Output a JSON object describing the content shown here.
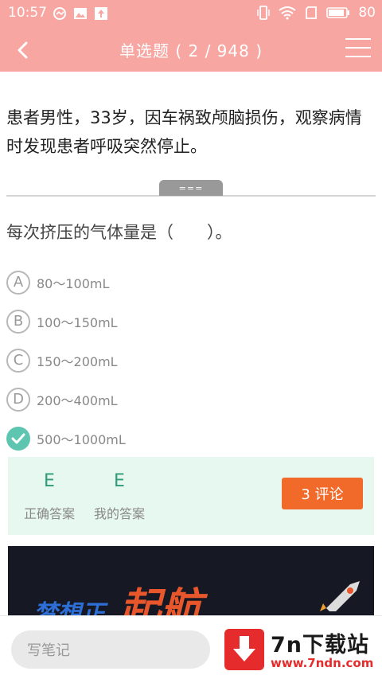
{
  "status_bar": {
    "time": "10:57",
    "battery": "80",
    "icons": [
      "msg-icon",
      "image-icon",
      "upload-icon",
      "vibrate-icon",
      "wifi-icon",
      "sim-icon",
      "battery-icon"
    ]
  },
  "nav": {
    "title": "单选题 ( 2 / 948 )",
    "back_icon": "chevron-left-icon",
    "menu_icon": "hamburger-menu-icon"
  },
  "question": {
    "stem": "患者男性，33岁，因车祸致颅脑损伤，观察病情时发现患者呼吸突然停止。",
    "handle_label": "===",
    "text": "每次挤压的气体量是（　　）。",
    "options": [
      {
        "letter": "A",
        "text": "80～100mL"
      },
      {
        "letter": "B",
        "text": "100～150mL"
      },
      {
        "letter": "C",
        "text": "150～200mL"
      },
      {
        "letter": "D",
        "text": "200～400mL"
      },
      {
        "letter": "E",
        "text": "500～1000mL",
        "selected": true
      }
    ]
  },
  "answer": {
    "correct_letter": "E",
    "correct_label": "正确答案",
    "my_letter": "E",
    "my_label": "我的答案",
    "comment_button": "3 评论"
  },
  "banner": {
    "text_left": "梦想正",
    "text_right": "起航"
  },
  "bottom": {
    "note_placeholder": "写笔记"
  },
  "watermark": {
    "text": "7n下载站",
    "url": "www.7ndn.com"
  },
  "colors": {
    "header": "#f7a6a2",
    "accent_green": "#5ec6b0",
    "answer_bg": "#e7f8f1",
    "comment_btn": "#f26a2a"
  }
}
